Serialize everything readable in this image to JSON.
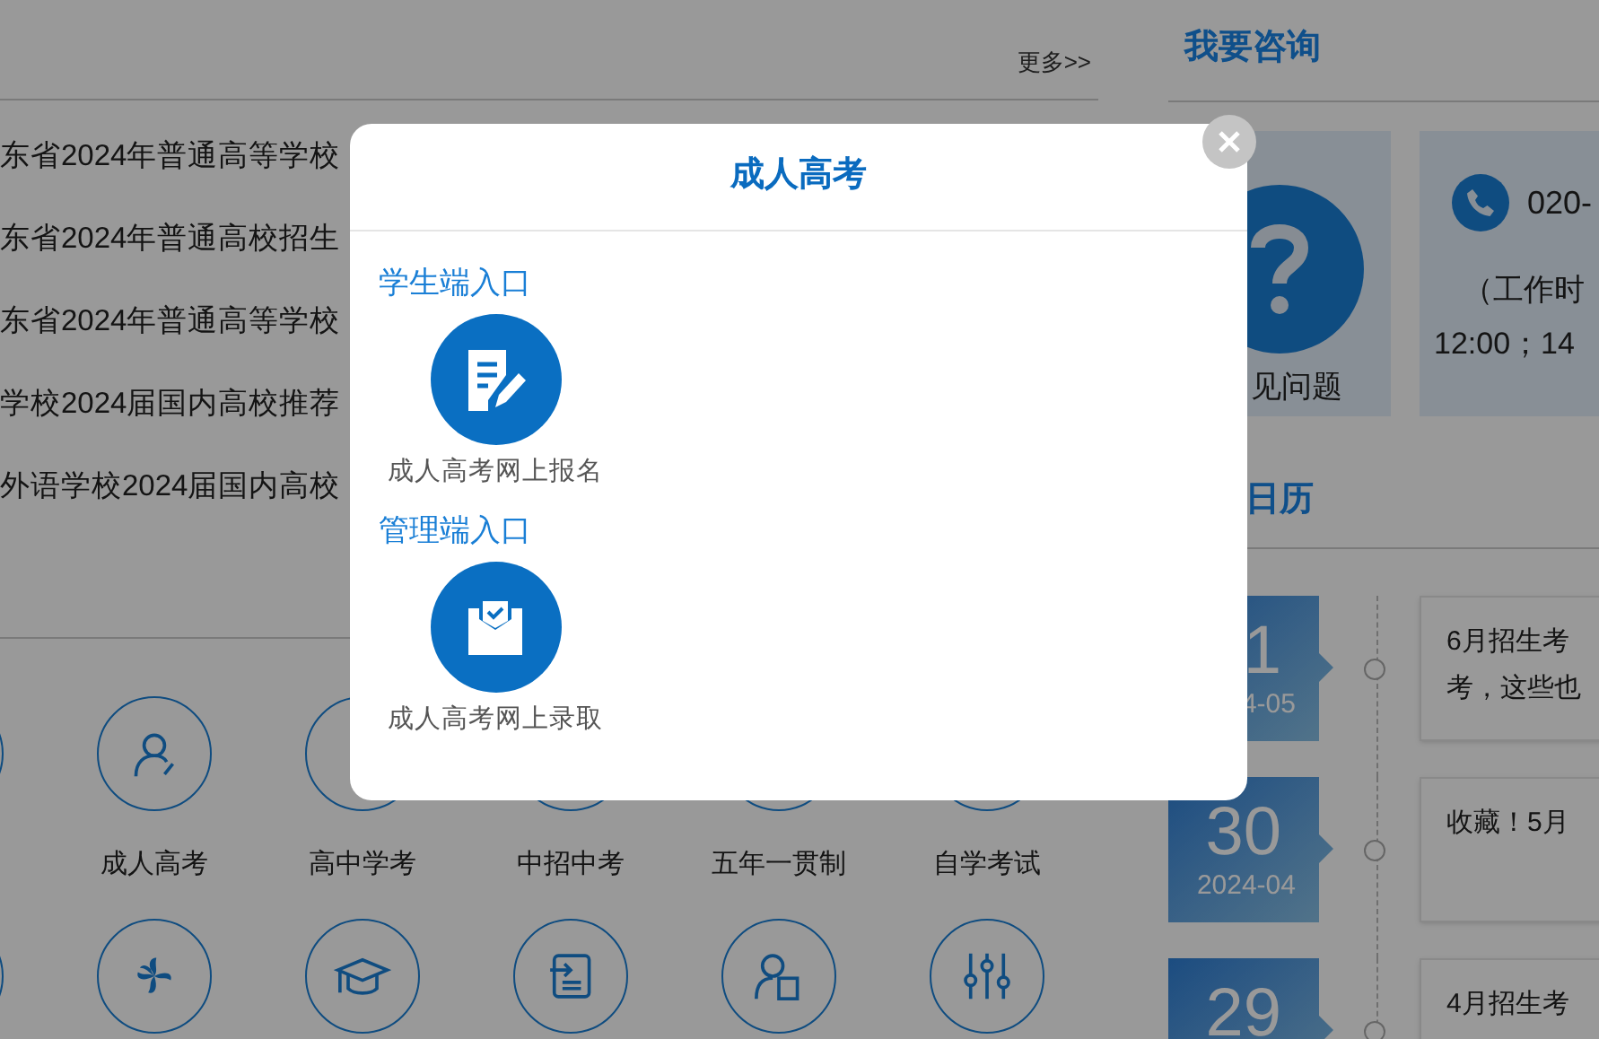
{
  "news": {
    "more": "更多>>",
    "items": [
      "东省2024年普通高等学校",
      "东省2024年普通高校招生",
      "东省2024年普通高等学校",
      "学校2024届国内高校推荐",
      "外语学校2024届国内高校"
    ]
  },
  "services": {
    "labels": [
      "成人高考",
      "高中学考",
      "中招中考",
      "五年一贯制",
      "自学考试"
    ]
  },
  "consult": {
    "title": "我要咨询",
    "faq": "见问题",
    "phone": "020-",
    "hours": [
      "（工作时",
      "12:00；14"
    ]
  },
  "calendar": {
    "title": "日历",
    "events": [
      {
        "day": "1",
        "month": "4-05",
        "lines": [
          "6月招生考",
          "考，这些也"
        ]
      },
      {
        "day": "30",
        "month": "2024-04",
        "lines": [
          "收藏！5月"
        ]
      },
      {
        "day": "29",
        "lines": [
          "4月招生考"
        ]
      }
    ]
  },
  "modal": {
    "title": "成人高考",
    "sections": [
      {
        "heading": "学生端入口",
        "entry": "成人高考网上报名",
        "kind": "register"
      },
      {
        "heading": "管理端入口",
        "entry": "成人高考网上录取",
        "kind": "admit"
      }
    ]
  }
}
